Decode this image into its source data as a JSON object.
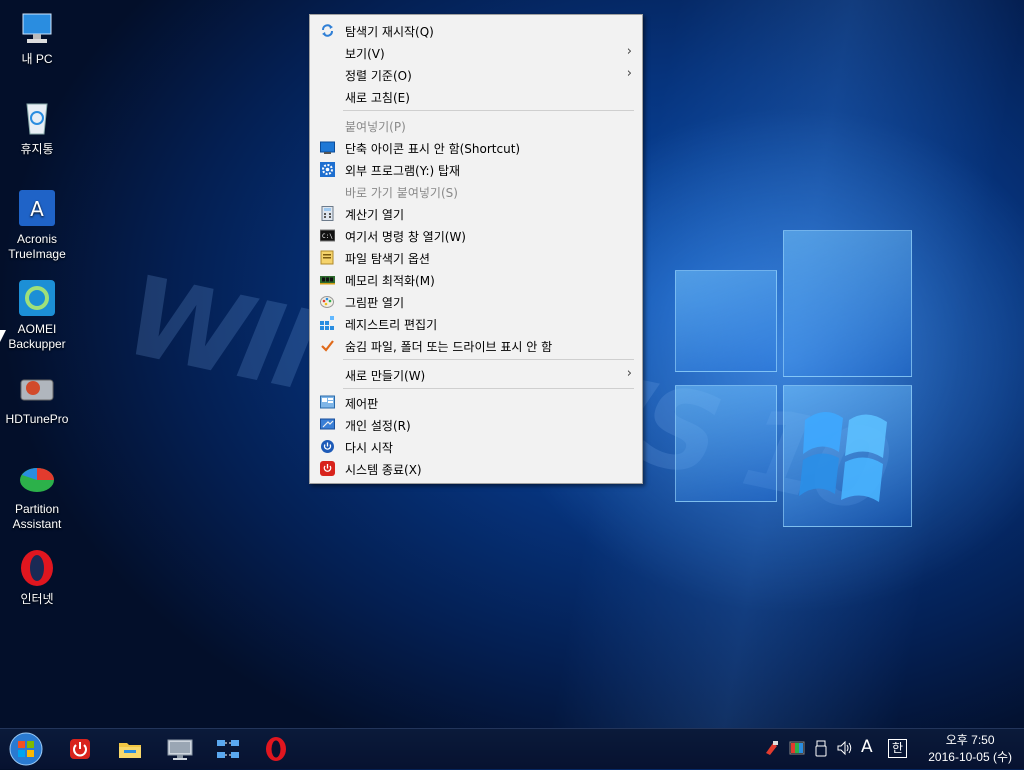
{
  "desktop": {
    "icons": [
      {
        "label_line1": "내 PC",
        "label_line2": "",
        "icon": "computer-icon"
      },
      {
        "label_line1": "휴지통",
        "label_line2": "",
        "icon": "recycle-bin-icon"
      },
      {
        "label_line1": "Acronis",
        "label_line2": "TrueImage",
        "icon": "acronis-icon"
      },
      {
        "label_line1": "AOMEI",
        "label_line2": "Backupper",
        "icon": "aomei-icon"
      },
      {
        "label_line1": "HDTunePro",
        "label_line2": "",
        "icon": "hdtune-icon"
      },
      {
        "label_line1": "Partition",
        "label_line2": "Assistant",
        "icon": "partition-icon"
      },
      {
        "label_line1": "인터넷",
        "label_line2": "",
        "icon": "opera-icon"
      }
    ],
    "wallpaper_text": "WINDOWS 10"
  },
  "context_menu": {
    "items": [
      {
        "label": "탐색기 재시작(Q)",
        "icon": "refresh-icon",
        "disabled": false,
        "submenu": false
      },
      {
        "label": "보기(V)",
        "icon": "",
        "disabled": false,
        "submenu": true
      },
      {
        "label": "정렬 기준(O)",
        "icon": "",
        "disabled": false,
        "submenu": true
      },
      {
        "label": "새로 고침(E)",
        "icon": "",
        "disabled": false,
        "submenu": false
      },
      {
        "label": "붙여넣기(P)",
        "icon": "",
        "disabled": true,
        "submenu": false
      },
      {
        "label": "단축 아이콘 표시 안 함(Shortcut)",
        "icon": "monitor-icon",
        "disabled": false,
        "submenu": false
      },
      {
        "label": "외부 프로그램(Y:) 탑재",
        "icon": "gear-icon",
        "disabled": false,
        "submenu": false
      },
      {
        "label": "바로 가기 붙여넣기(S)",
        "icon": "",
        "disabled": true,
        "submenu": false
      },
      {
        "label": "계산기 열기",
        "icon": "calculator-icon",
        "disabled": false,
        "submenu": false
      },
      {
        "label": "여기서 명령 창 열기(W)",
        "icon": "cmd-icon",
        "disabled": false,
        "submenu": false
      },
      {
        "label": "파일 탐색기 옵션",
        "icon": "folder-options-icon",
        "disabled": false,
        "submenu": false
      },
      {
        "label": "메모리 최적화(M)",
        "icon": "memory-icon",
        "disabled": false,
        "submenu": false
      },
      {
        "label": "그림판 열기",
        "icon": "paint-icon",
        "disabled": false,
        "submenu": false
      },
      {
        "label": "레지스트리 편집기",
        "icon": "registry-icon",
        "disabled": false,
        "submenu": false
      },
      {
        "label": "숨김 파일, 폴더 또는 드라이브 표시 안 함",
        "icon": "checkmark-icon",
        "disabled": false,
        "submenu": false
      },
      {
        "label": "새로 만들기(W)",
        "icon": "",
        "disabled": false,
        "submenu": true
      },
      {
        "label": "제어판",
        "icon": "control-panel-icon",
        "disabled": false,
        "submenu": false
      },
      {
        "label": "개인 설정(R)",
        "icon": "personalize-icon",
        "disabled": false,
        "submenu": false
      },
      {
        "label": "다시 시작",
        "icon": "restart-icon",
        "disabled": false,
        "submenu": false
      },
      {
        "label": "시스템 종료(X)",
        "icon": "power-icon",
        "disabled": false,
        "submenu": false
      }
    ]
  },
  "taskbar": {
    "pinned": [
      "start-orb-icon",
      "power-icon",
      "folder-icon",
      "monitor-icon",
      "network-icon",
      "opera-icon"
    ],
    "tray": {
      "ime_a": "A",
      "ime_han": "한"
    },
    "clock": {
      "time": "오후 7:50",
      "date": "2016-10-05 (수)"
    }
  }
}
